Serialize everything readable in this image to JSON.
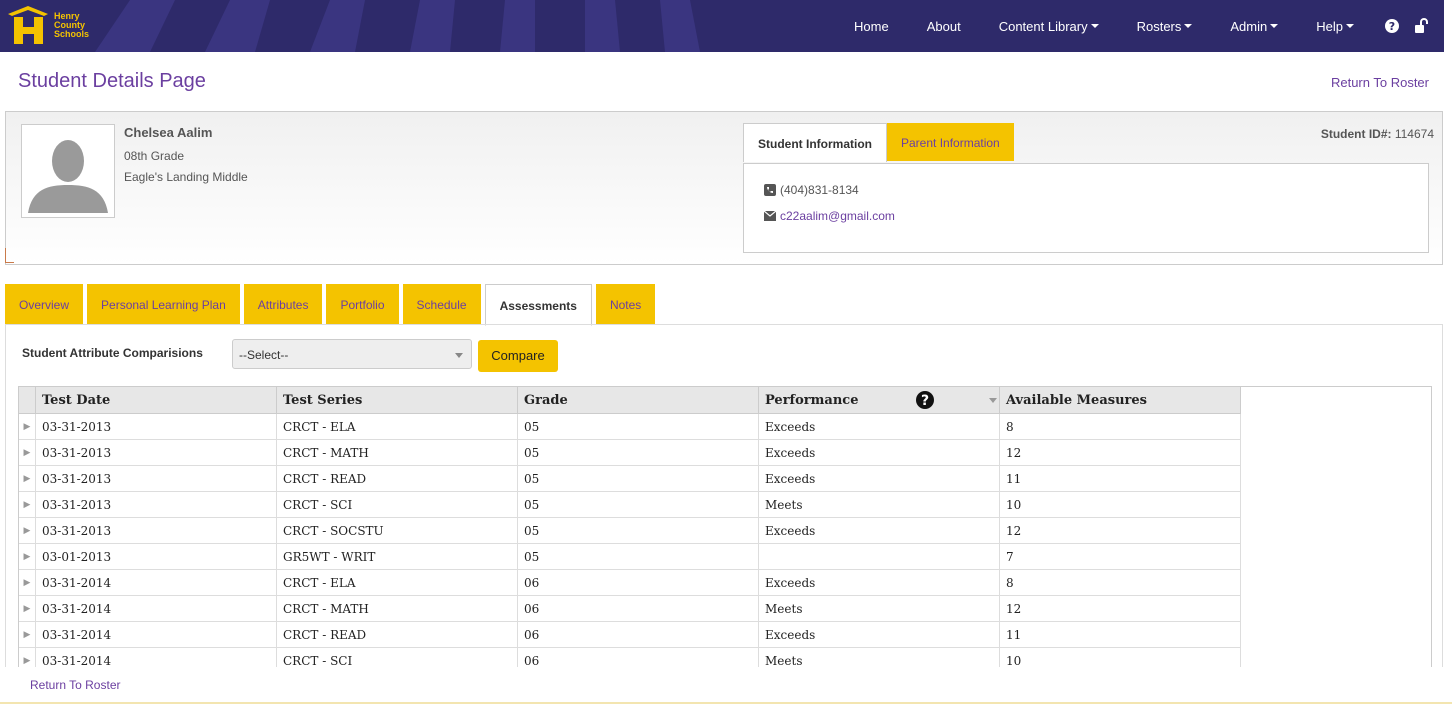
{
  "logo": {
    "line1": "Henry",
    "line2": "County",
    "line3": "Schools"
  },
  "nav": {
    "items": [
      {
        "label": "Home",
        "dropdown": false
      },
      {
        "label": "About",
        "dropdown": false
      },
      {
        "label": "Content Library",
        "dropdown": true
      },
      {
        "label": "Rosters",
        "dropdown": true
      },
      {
        "label": "Admin",
        "dropdown": true
      },
      {
        "label": "Help",
        "dropdown": true
      }
    ],
    "icons": [
      "help-circle-icon",
      "unlock-icon"
    ]
  },
  "page": {
    "title": "Student Details Page",
    "return_link": "Return To Roster"
  },
  "student": {
    "name": "Chelsea Aalim",
    "grade": "08th Grade",
    "school": "Eagle's Landing Middle",
    "id_label": "Student ID#:",
    "id_value": "114674",
    "phone": "(404)831-8134",
    "email": "c22aalim@gmail.com"
  },
  "info_tabs": {
    "student": "Student Information",
    "parent": "Parent Information"
  },
  "tabs": [
    "Overview",
    "Personal Learning Plan",
    "Attributes",
    "Portfolio",
    "Schedule",
    "Assessments",
    "Notes"
  ],
  "active_tab": "Assessments",
  "compare": {
    "label": "Student Attribute Comparisions",
    "select_value": "--Select--",
    "button": "Compare"
  },
  "grid": {
    "columns": [
      "Test Date",
      "Test Series",
      "Grade",
      "Performance",
      "Available Measures"
    ],
    "rows": [
      [
        "03-31-2013",
        "CRCT - ELA",
        "05",
        "Exceeds",
        "8"
      ],
      [
        "03-31-2013",
        "CRCT - MATH",
        "05",
        "Exceeds",
        "12"
      ],
      [
        "03-31-2013",
        "CRCT - READ",
        "05",
        "Exceeds",
        "11"
      ],
      [
        "03-31-2013",
        "CRCT - SCI",
        "05",
        "Meets",
        "10"
      ],
      [
        "03-31-2013",
        "CRCT - SOCSTU",
        "05",
        "Exceeds",
        "12"
      ],
      [
        "03-01-2013",
        "GR5WT - WRIT",
        "05",
        "",
        "7"
      ],
      [
        "03-31-2014",
        "CRCT - ELA",
        "06",
        "Exceeds",
        "8"
      ],
      [
        "03-31-2014",
        "CRCT - MATH",
        "06",
        "Meets",
        "12"
      ],
      [
        "03-31-2014",
        "CRCT - READ",
        "06",
        "Exceeds",
        "11"
      ],
      [
        "03-31-2014",
        "CRCT - SCI",
        "06",
        "Meets",
        "10"
      ]
    ]
  },
  "footer": {
    "return_link": "Return To Roster"
  },
  "colors": {
    "nav_bg": "#2e2a6a",
    "accent_gold": "#f4c300",
    "link_purple": "#6b3fa0"
  }
}
